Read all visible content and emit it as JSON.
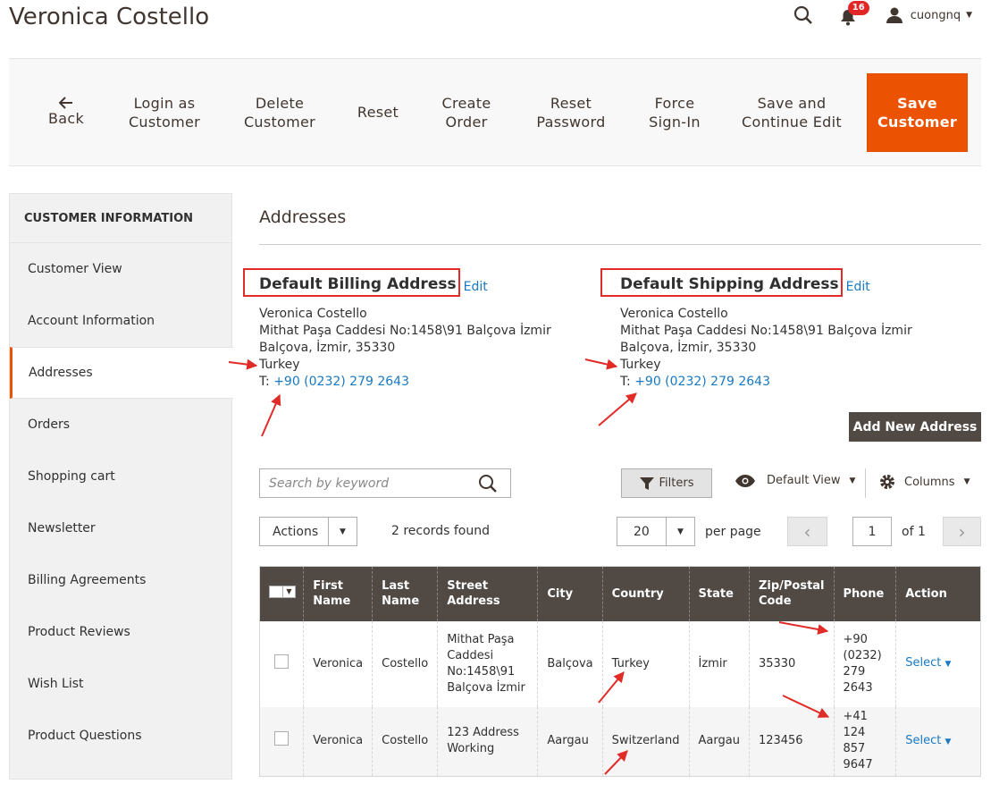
{
  "header": {
    "title": "Veronica Costello",
    "notifications_count": "16",
    "username": "cuongnq"
  },
  "toolbar": {
    "back": "Back",
    "login_as_customer": "Login as Customer",
    "delete_customer": "Delete Customer",
    "reset": "Reset",
    "create_order": "Create Order",
    "reset_password": "Reset Password",
    "force_sign_in": "Force Sign-In",
    "save_and_continue": "Save and Continue Edit",
    "save_customer": "Save Customer"
  },
  "sidebar": {
    "title": "CUSTOMER INFORMATION",
    "items": [
      {
        "label": "Customer View"
      },
      {
        "label": "Account Information"
      },
      {
        "label": "Addresses"
      },
      {
        "label": "Orders"
      },
      {
        "label": "Shopping cart"
      },
      {
        "label": "Newsletter"
      },
      {
        "label": "Billing Agreements"
      },
      {
        "label": "Product Reviews"
      },
      {
        "label": "Wish List"
      },
      {
        "label": "Product Questions"
      }
    ]
  },
  "addresses": {
    "section_title": "Addresses",
    "billing": {
      "title": "Default Billing Address",
      "edit": "Edit",
      "name": "Veronica Costello",
      "street": "Mithat Paşa Caddesi No:1458\\91 Balçova İzmir",
      "city_line": "Balçova, İzmir, 35330",
      "country": "Turkey",
      "phone_prefix": "T:",
      "phone": "+90 (0232) 279 2643"
    },
    "shipping": {
      "title": "Default Shipping Address",
      "edit": "Edit",
      "name": "Veronica Costello",
      "street": "Mithat Paşa Caddesi No:1458\\91 Balçova İzmir",
      "city_line": "Balçova, İzmir, 35330",
      "country": "Turkey",
      "phone_prefix": "T:",
      "phone": "+90 (0232) 279 2643"
    },
    "add_new": "Add New Address"
  },
  "grid_toolbar": {
    "search_placeholder": "Search by keyword",
    "filters": "Filters",
    "default_view": "Default View",
    "columns": "Columns",
    "actions": "Actions",
    "records_found": "2 records found",
    "per_page_value": "20",
    "per_page_label": "per page",
    "current_page": "1",
    "of_pages": "of 1"
  },
  "grid": {
    "columns": {
      "first_name": "First Name",
      "last_name": "Last Name",
      "street": "Street Address",
      "city": "City",
      "country": "Country",
      "state": "State",
      "zip": "Zip/Postal Code",
      "phone": "Phone",
      "action": "Action"
    },
    "rows": [
      {
        "first_name": "Veronica",
        "last_name": "Costello",
        "street": "Mithat Paşa Caddesi No:1458\\91 Balçova İzmir",
        "city": "Balçova",
        "country": "Turkey",
        "state": "İzmir",
        "zip": "35330",
        "phone": "+90 (0232) 279 2643",
        "action": "Select"
      },
      {
        "first_name": "Veronica",
        "last_name": "Costello",
        "street": "123 Address Working",
        "city": "Aargau",
        "country": "Switzerland",
        "state": "Aargau",
        "zip": "123456",
        "phone": "+41 124 857 9647",
        "action": "Select"
      }
    ]
  },
  "colors": {
    "accent": "#eb5202",
    "link": "#1979c3",
    "header_dark": "#514943",
    "annotation_red": "#e02b27"
  }
}
